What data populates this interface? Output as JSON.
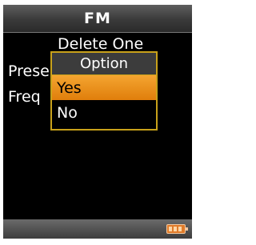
{
  "header": {
    "title": "FM"
  },
  "background": {
    "heading": "Delete One",
    "rows": [
      "Prese",
      "Freq"
    ]
  },
  "popup": {
    "title": "Option",
    "items": [
      {
        "label": "Yes",
        "selected": true
      },
      {
        "label": "No",
        "selected": false
      }
    ]
  },
  "status": {
    "battery_icon": "battery-icon"
  },
  "colors": {
    "accent": "#e88a1a",
    "border": "#c8a11a",
    "screen_bg": "#000000"
  }
}
